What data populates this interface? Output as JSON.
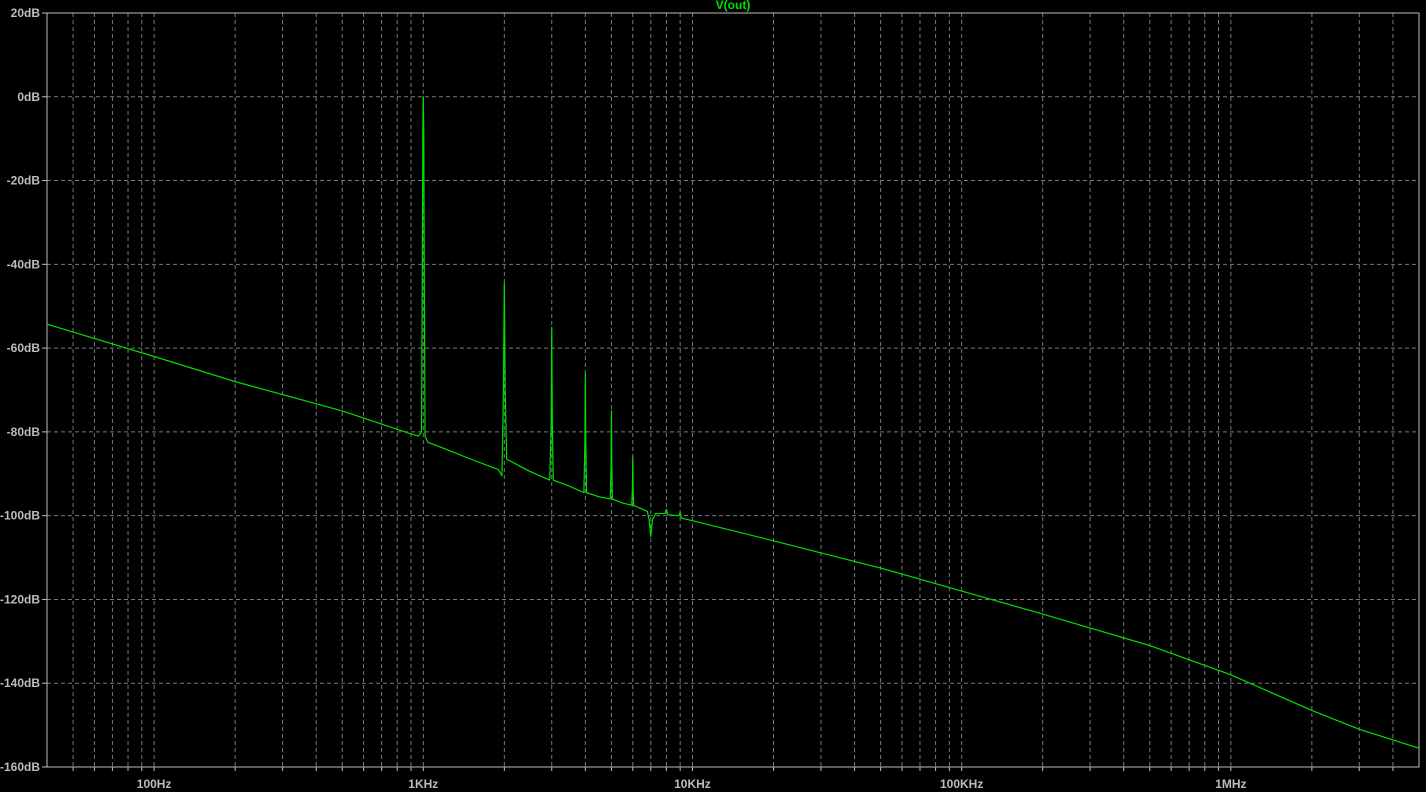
{
  "chart_data": {
    "type": "line",
    "title": "V(out)",
    "xlabel": "",
    "ylabel": "",
    "x_scale": "log",
    "xlim": [
      40,
      5000000
    ],
    "ylim": [
      -160,
      20
    ],
    "grid": true,
    "colors": {
      "background": "#000000",
      "trace": "#00e000",
      "title": "#00e000",
      "axis": "#bdbdbd",
      "grid": "#7a7a7a"
    },
    "x_ticks": [
      {
        "value": 100,
        "label": "100Hz"
      },
      {
        "value": 1000,
        "label": "1KHz"
      },
      {
        "value": 10000,
        "label": "10KHz"
      },
      {
        "value": 100000,
        "label": "100KHz"
      },
      {
        "value": 1000000,
        "label": "1MHz"
      }
    ],
    "y_ticks": [
      {
        "value": 20,
        "label": "20dB"
      },
      {
        "value": 0,
        "label": "0dB"
      },
      {
        "value": -20,
        "label": "-20dB"
      },
      {
        "value": -40,
        "label": "-40dB"
      },
      {
        "value": -60,
        "label": "-60dB"
      },
      {
        "value": -80,
        "label": "-80dB"
      },
      {
        "value": -100,
        "label": "-100dB"
      },
      {
        "value": -120,
        "label": "-120dB"
      },
      {
        "value": -140,
        "label": "-140dB"
      },
      {
        "value": -160,
        "label": "-160dB"
      }
    ],
    "series": [
      {
        "name": "V(out)",
        "points": [
          [
            40,
            -54.3
          ],
          [
            100,
            -62
          ],
          [
            200,
            -68
          ],
          [
            500,
            -75
          ],
          [
            900,
            -80.5
          ],
          [
            960,
            -81
          ],
          [
            985,
            -80
          ],
          [
            992,
            -40
          ],
          [
            996,
            -8
          ],
          [
            1000,
            0
          ],
          [
            1004,
            -8
          ],
          [
            1008,
            -40
          ],
          [
            1015,
            -81
          ],
          [
            1040,
            -82.5
          ],
          [
            1200,
            -84
          ],
          [
            1500,
            -86.5
          ],
          [
            1900,
            -89
          ],
          [
            1960,
            -90.5
          ],
          [
            1985,
            -70
          ],
          [
            2000,
            -44.5
          ],
          [
            2015,
            -70
          ],
          [
            2040,
            -86.5
          ],
          [
            2500,
            -89.5
          ],
          [
            2950,
            -91.5
          ],
          [
            2985,
            -78
          ],
          [
            3000,
            -55
          ],
          [
            3015,
            -78
          ],
          [
            3040,
            -91.5
          ],
          [
            3500,
            -93
          ],
          [
            3950,
            -94.5
          ],
          [
            3985,
            -82
          ],
          [
            4000,
            -66
          ],
          [
            4015,
            -82
          ],
          [
            4040,
            -94.5
          ],
          [
            4500,
            -95.5
          ],
          [
            4950,
            -96
          ],
          [
            4985,
            -88
          ],
          [
            5000,
            -75
          ],
          [
            5015,
            -88
          ],
          [
            5040,
            -96
          ],
          [
            5500,
            -97
          ],
          [
            5950,
            -97.5
          ],
          [
            5985,
            -93
          ],
          [
            6000,
            -86
          ],
          [
            6015,
            -93
          ],
          [
            6040,
            -97.5
          ],
          [
            6800,
            -99
          ],
          [
            6900,
            -101
          ],
          [
            7000,
            -105
          ],
          [
            7100,
            -101
          ],
          [
            7300,
            -99.5
          ],
          [
            7900,
            -99.5
          ],
          [
            8000,
            -98.5
          ],
          [
            8100,
            -99.8
          ],
          [
            8900,
            -100
          ],
          [
            9000,
            -99.2
          ],
          [
            9100,
            -100.6
          ],
          [
            10000,
            -101.2
          ],
          [
            20000,
            -106
          ],
          [
            50000,
            -112.5
          ],
          [
            100000,
            -118
          ],
          [
            200000,
            -123.5
          ],
          [
            500000,
            -131
          ],
          [
            1000000,
            -138
          ],
          [
            2000000,
            -146.5
          ],
          [
            3000000,
            -151
          ],
          [
            5000000,
            -155.5
          ]
        ]
      }
    ]
  }
}
